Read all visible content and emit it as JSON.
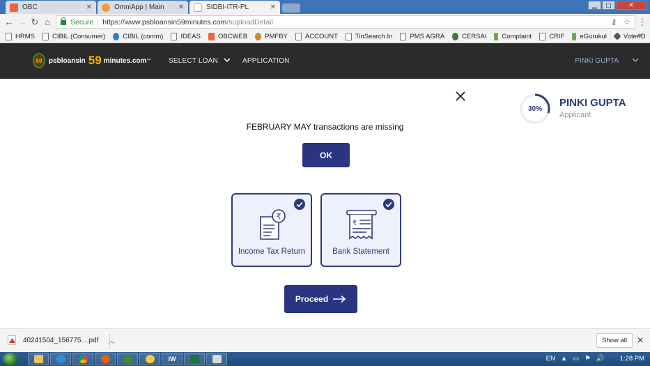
{
  "browser": {
    "tabs": [
      {
        "title": "OBC",
        "favicon_color": "#e8683a",
        "active": false
      },
      {
        "title": "OmniApp | Main",
        "favicon_color": "#f39a3b",
        "active": false
      },
      {
        "title": "SIDBI-ITR-PL",
        "favicon_color": "#cccccc",
        "active": true
      }
    ],
    "secure_label": "Secure",
    "url_host": "https://www.psbloansin59minutes.com",
    "url_path": "/suploadDetail",
    "bookmarks": [
      "HRMS",
      "CIBIL (Consumer)",
      "CIBIL (comm)",
      "IDEAS",
      "OBCWEB",
      "PMFBY",
      "ACCOUNT",
      "TinSearch.In",
      "PMS AGRA",
      "CERSAI",
      "Complaint",
      "CRIF",
      "eGurukul",
      "VoterID"
    ],
    "bookmarks_more": "»"
  },
  "header": {
    "logo_text": "psbloansin",
    "logo_number": "59",
    "logo_suffix": "minutes.com",
    "logo_tm": "™",
    "logo_badge": "59",
    "nav_select_loan": "SELECT LOAN",
    "nav_application": "APPLICATION",
    "user_name": "PINKI GUPTA"
  },
  "applicant": {
    "progress_label": "30%",
    "progress_fraction": 0.3,
    "name": "PINKI GUPTA",
    "role": "Applicant"
  },
  "dialog": {
    "message": "FEBRUARY MAY transactions are missing",
    "ok_label": "OK"
  },
  "documents": [
    {
      "label": "Income Tax Return",
      "checked": true
    },
    {
      "label": "Bank Statement",
      "checked": true
    }
  ],
  "proceed_label": "Proceed",
  "download_bar": {
    "filename": "40241504_156775....pdf",
    "show_all_label": "Show all"
  },
  "taskbar": {
    "language": "EN",
    "time": "1:28 PM"
  },
  "colors": {
    "primary": "#2b3480",
    "accent_text": "#2e3a7c",
    "header_bg": "#2b2b2b",
    "card_bg": "#eef0fb"
  }
}
